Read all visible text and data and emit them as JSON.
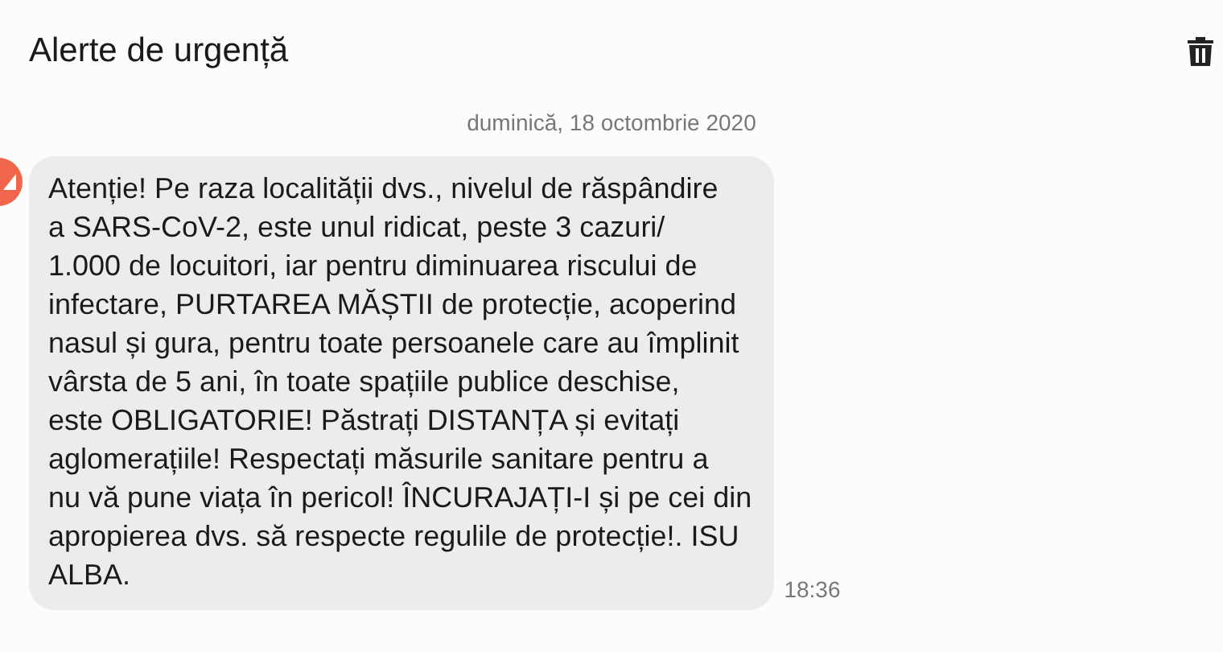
{
  "header": {
    "title": "Alerte de urgență"
  },
  "date_separator": "duminică, 18 octombrie 2020",
  "message": {
    "text": "Atenție! Pe raza localității dvs., nivelul de răspândire\na SARS-CoV-2, este unul ridicat, peste 3 cazuri/\n1.000 de locuitori, iar pentru diminuarea riscului de\ninfectare, PURTAREA MĂȘTII de protecție, acoperind\nnasul și gura, pentru toate persoanele care au împlinit\nvârsta de 5 ani, în toate spațiile publice deschise,\neste OBLIGATORIE! Păstrați DISTANȚA și evitați\naglomerațiile! Respectați măsurile sanitare pentru a\nnu vă pune viața în pericol! ÎNCURAJAȚI-I și pe cei din\napropierea dvs. să respecte regulile de protecție!. ISU\nALBA.",
    "time": "18:36"
  }
}
